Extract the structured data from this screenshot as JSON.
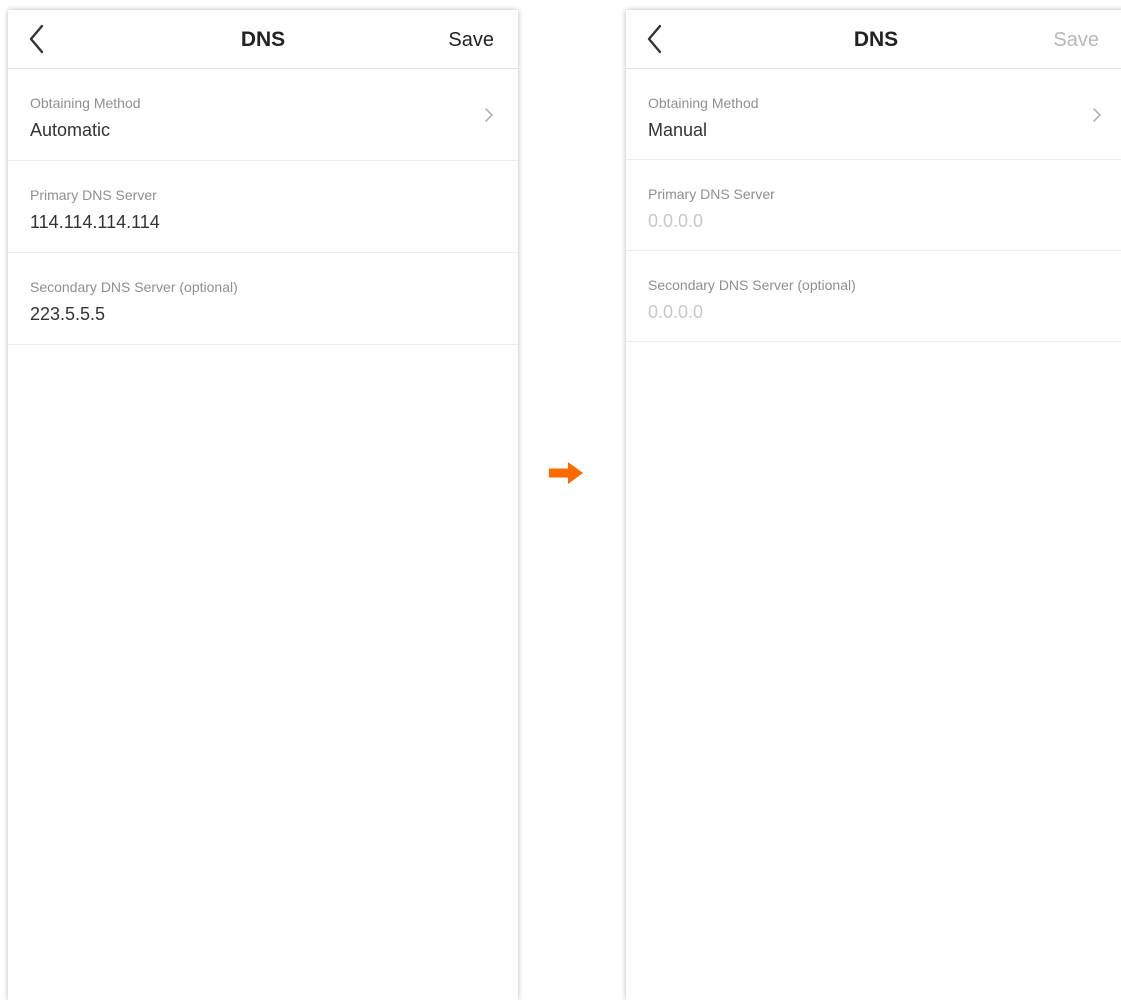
{
  "colors": {
    "accent_arrow": "#ff6a00",
    "label_gray": "#8f8f8f",
    "placeholder_gray": "#c8c8c8",
    "disabled_save": "#b8b8b8"
  },
  "screens": [
    {
      "nav": {
        "title": "DNS",
        "save_label": "Save",
        "back_icon": "chevron-left-icon"
      },
      "rows": [
        {
          "label": "Obtaining Method",
          "value": "Automatic",
          "has_chevron": true
        },
        {
          "label": "Primary DNS Server",
          "value": "114.114.114.114"
        },
        {
          "label": "Secondary DNS Server (optional)",
          "value": "223.5.5.5"
        }
      ]
    },
    {
      "nav": {
        "title": "DNS",
        "save_label": "Save",
        "save_disabled": true,
        "back_icon": "chevron-left-icon"
      },
      "rows": [
        {
          "label": "Obtaining Method",
          "value": "Manual",
          "has_chevron": true
        },
        {
          "label": "Primary DNS Server",
          "placeholder": "0.0.0.0"
        },
        {
          "label": "Secondary DNS Server (optional)",
          "placeholder": "0.0.0.0"
        }
      ]
    }
  ],
  "transition_icon": "arrow-right-icon"
}
